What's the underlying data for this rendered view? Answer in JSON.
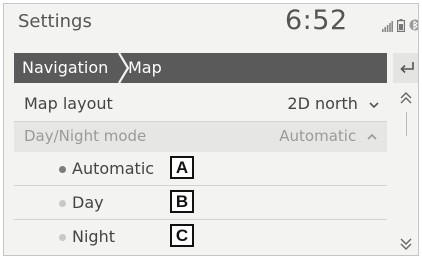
{
  "status_bar": {
    "title": "Settings",
    "clock": "6:52",
    "icons": [
      "signal-strength-icon",
      "battery-icon",
      "bluetooth-icon"
    ]
  },
  "breadcrumb": {
    "items": [
      "Navigation",
      "Map"
    ]
  },
  "settings": {
    "map_layout": {
      "label": "Map layout",
      "value": "2D north"
    },
    "day_night_mode": {
      "label": "Day/Night mode",
      "value": "Automatic"
    }
  },
  "options": [
    {
      "label": "Automatic",
      "callout": "A"
    },
    {
      "label": "Day",
      "callout": "B"
    },
    {
      "label": "Night",
      "callout": "C"
    }
  ],
  "colors": {
    "breadcrumb_bg": "#5a5a5a",
    "selected_dot": "#7c7c7c",
    "unselected_dot": "#c8c8c8"
  }
}
